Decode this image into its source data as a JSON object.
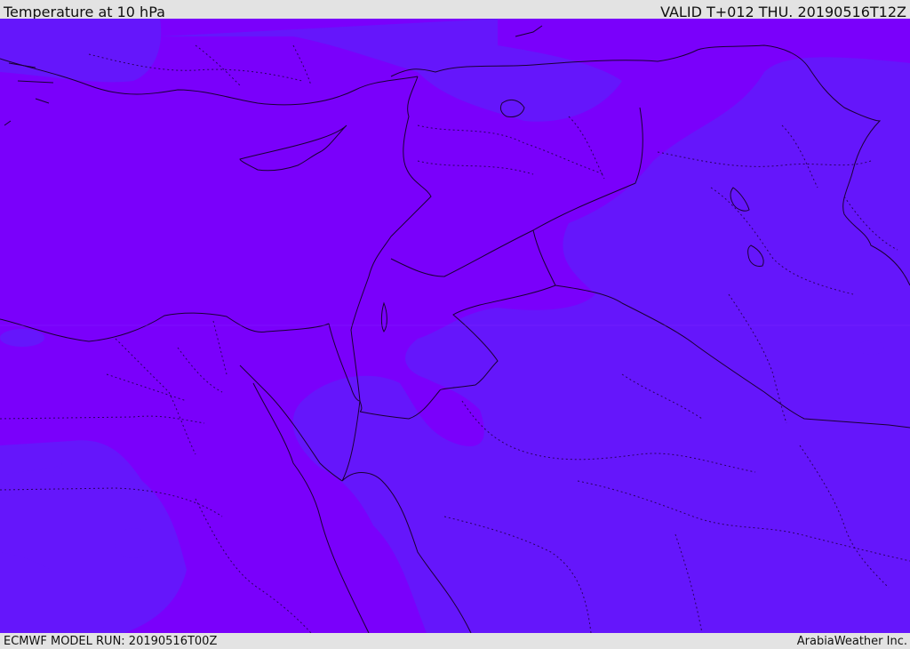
{
  "header": {
    "title": "Temperature at 10 hPa",
    "valid_time": "VALID T+012 THU. 20190516T12Z"
  },
  "footer": {
    "model_run": "ECMWF MODEL RUN: 20190516T00Z",
    "credit": "ArabiaWeather Inc."
  },
  "colors": {
    "header_bg": "#e3e3e3",
    "field_warm": "#7a00fb",
    "field_cool": "#6516fb",
    "coast_line": "#1a0033",
    "admin_line": "#2a0060"
  },
  "map": {
    "parameter": "temperature",
    "level": "10 hPa",
    "region": "Eastern Mediterranean / Levant / Arabian Peninsula"
  }
}
